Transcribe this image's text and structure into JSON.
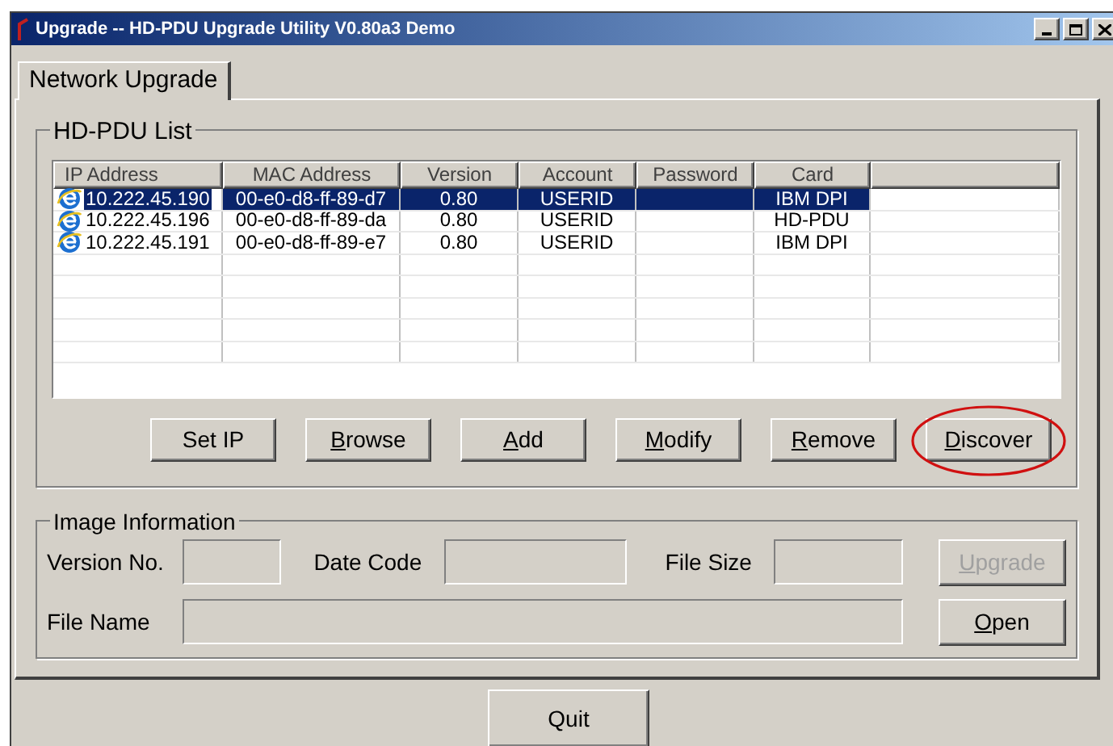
{
  "window": {
    "title": "Upgrade -- HD-PDU Upgrade Utility V0.80a3 Demo"
  },
  "tabs": [
    {
      "label": "Network Upgrade",
      "selected": true
    }
  ],
  "list_group": {
    "title": "HD-PDU List"
  },
  "table": {
    "columns": [
      "IP Address",
      "MAC Address",
      "Version",
      "Account",
      "Password",
      "Card"
    ],
    "rows": [
      {
        "selected": true,
        "cells": [
          "10.222.45.190",
          "00-e0-d8-ff-89-d7",
          "0.80",
          "USERID",
          "",
          "IBM DPI"
        ]
      },
      {
        "selected": false,
        "cells": [
          "10.222.45.196",
          "00-e0-d8-ff-89-da",
          "0.80",
          "USERID",
          "",
          "HD-PDU"
        ]
      },
      {
        "selected": false,
        "cells": [
          "10.222.45.191",
          "00-e0-d8-ff-89-e7",
          "0.80",
          "USERID",
          "",
          "IBM DPI"
        ]
      }
    ]
  },
  "list_buttons": [
    {
      "label": "Set IP",
      "mnemonic": false,
      "highlighted": false
    },
    {
      "label": "Browse",
      "mnemonic": true,
      "highlighted": false
    },
    {
      "label": "Add",
      "mnemonic": true,
      "highlighted": false
    },
    {
      "label": "Modify",
      "mnemonic": true,
      "highlighted": false
    },
    {
      "label": "Remove",
      "mnemonic": true,
      "highlighted": false
    },
    {
      "label": "Discover",
      "mnemonic": true,
      "highlighted": true
    }
  ],
  "image_group": {
    "title": "Image Information",
    "version_label": "Version No.",
    "date_label": "Date Code",
    "size_label": "File Size",
    "name_label": "File Name",
    "upgrade_button": {
      "label": "Upgrade",
      "disabled": true
    },
    "open_button": {
      "label": "Open",
      "disabled": false
    }
  },
  "quit_button": {
    "label": "Quit"
  }
}
